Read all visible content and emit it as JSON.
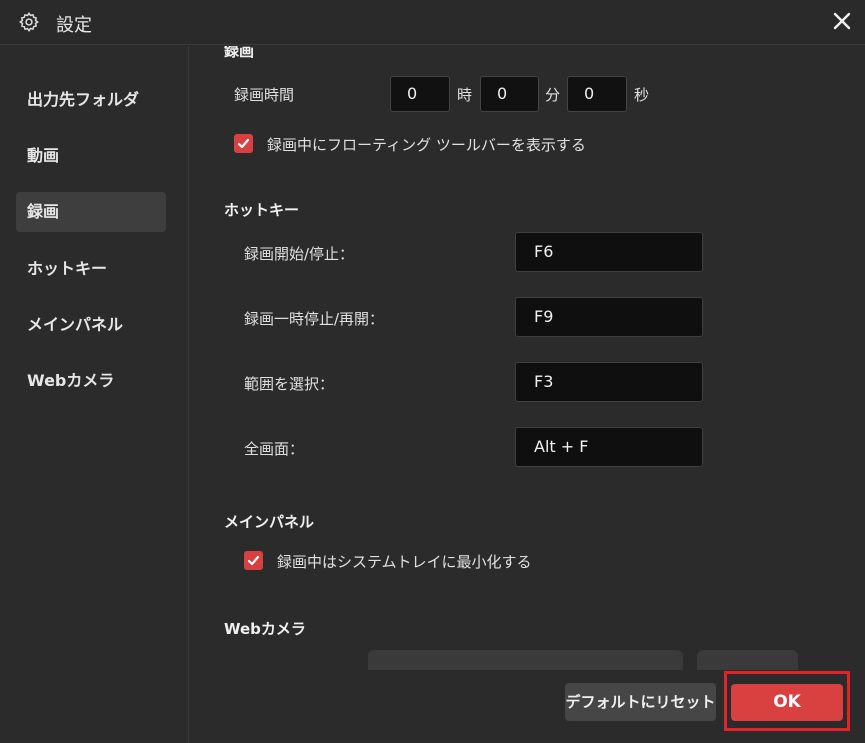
{
  "window": {
    "title": "設定",
    "gear_icon": "gear-icon",
    "close_icon": "close-icon"
  },
  "sidebar": {
    "items": [
      {
        "label": "出力先フォルダ"
      },
      {
        "label": "動画"
      },
      {
        "label": "録画",
        "active": true
      },
      {
        "label": "ホットキー"
      },
      {
        "label": "メインパネル"
      },
      {
        "label": "Webカメラ"
      }
    ]
  },
  "recording": {
    "section_title": "録画",
    "time_label": "録画時間",
    "hours": "0",
    "hours_unit": "時",
    "minutes": "0",
    "minutes_unit": "分",
    "seconds": "0",
    "seconds_unit": "秒",
    "floating_toolbar_label": "録画中にフローティング ツールバーを表示する",
    "floating_toolbar_checked": true
  },
  "hotkeys": {
    "section_title": "ホットキー",
    "items": [
      {
        "label": "録画開始/停止：",
        "value": "F6"
      },
      {
        "label": "録画一時停止/再開：",
        "value": "F9"
      },
      {
        "label": "範囲を選択：",
        "value": "F3"
      },
      {
        "label": "全画面：",
        "value": "Alt + F"
      }
    ]
  },
  "main_panel": {
    "section_title": "メインパネル",
    "minimize_to_tray_label": "録画中はシステムトレイに最小化する",
    "minimize_to_tray_checked": true
  },
  "webcam": {
    "section_title": "Webカメラ"
  },
  "footer": {
    "reset_label": "デフォルトにリセット",
    "ok_label": "OK"
  },
  "colors": {
    "accent": "#d94040",
    "highlight_frame": "#e0242b",
    "background": "#2b2b2b",
    "field": "#111111"
  }
}
